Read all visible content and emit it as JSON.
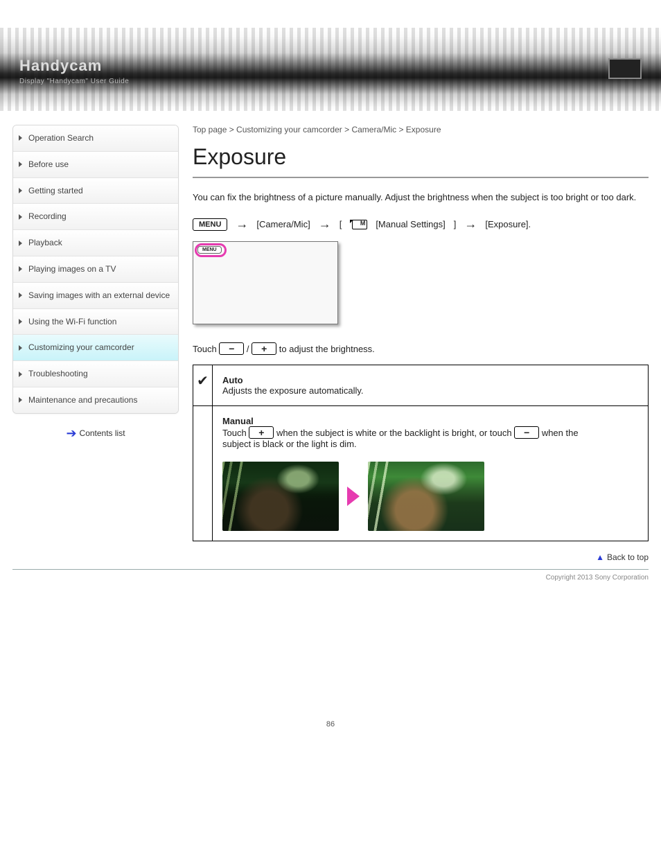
{
  "header": {
    "brand": "Handycam",
    "sub": "Display \"Handycam\" User Guide"
  },
  "breadcrumb": "Top page > Customizing your camcorder > Camera/Mic > Exposure",
  "page_title": "Exposure",
  "intro": "You can fix the brightness of a picture manually. Adjust the brightness when the subject is too bright or too dark.",
  "menu_path": {
    "step1": "[Camera/Mic]",
    "step2": "[Manual Settings]",
    "step3": "[Exposure]."
  },
  "screenshot_label": "MENU",
  "summary": "Touch / to adjust the brightness.",
  "table": {
    "auto": {
      "label": "Auto",
      "desc": "Adjusts the exposure automatically."
    },
    "manual": {
      "label": "Manual",
      "line1_a": "Touch ",
      "line1_b": " when the subject is white or the backlight is bright, or touch ",
      "line1_c": " when the",
      "line2": "subject is black or the light is dim."
    }
  },
  "sidebar": {
    "items": [
      {
        "label": "Operation Search"
      },
      {
        "label": "Before use"
      },
      {
        "label": "Getting started"
      },
      {
        "label": "Recording"
      },
      {
        "label": "Playback"
      },
      {
        "label": "Playing images on a TV"
      },
      {
        "label": "Saving images with an external device"
      },
      {
        "label": "Using the Wi-Fi function"
      },
      {
        "label": "Customizing your camcorder"
      },
      {
        "label": "Troubleshooting"
      },
      {
        "label": "Maintenance and precautions"
      }
    ],
    "contents": "Contents list"
  },
  "back_to_top": "Back to top",
  "copyright": "Copyright 2013 Sony Corporation",
  "page_number": "86"
}
